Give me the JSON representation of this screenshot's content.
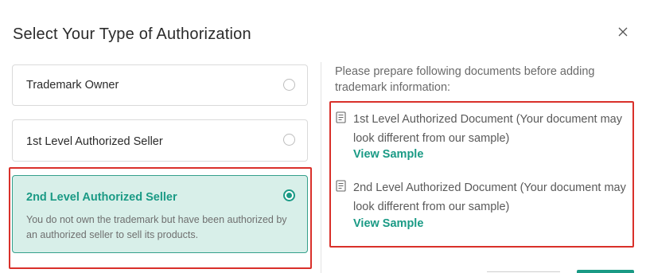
{
  "dialog": {
    "title": "Select Your Type of Authorization",
    "close_icon": "close-icon"
  },
  "options": [
    {
      "label": "Trademark Owner",
      "selected": false
    },
    {
      "label": "1st Level Authorized Seller",
      "selected": false
    },
    {
      "label": "2nd Level Authorized Seller",
      "selected": true,
      "description": "You do not own the trademark but have been authorized by an authorized seller to sell its products."
    }
  ],
  "documents": {
    "intro": "Please prepare following documents before adding trademark information:",
    "items": [
      {
        "icon": "document-icon",
        "text": "1st Level Authorized Document (Your document may look different from our sample)",
        "link": "View Sample"
      },
      {
        "icon": "document-icon",
        "text": "2nd Level Authorized Document (Your document may look different from our sample)",
        "link": "View Sample"
      }
    ]
  },
  "colors": {
    "accent": "#1a9a85",
    "selected_bg": "#d8efe9",
    "highlight": "#d9302a"
  }
}
